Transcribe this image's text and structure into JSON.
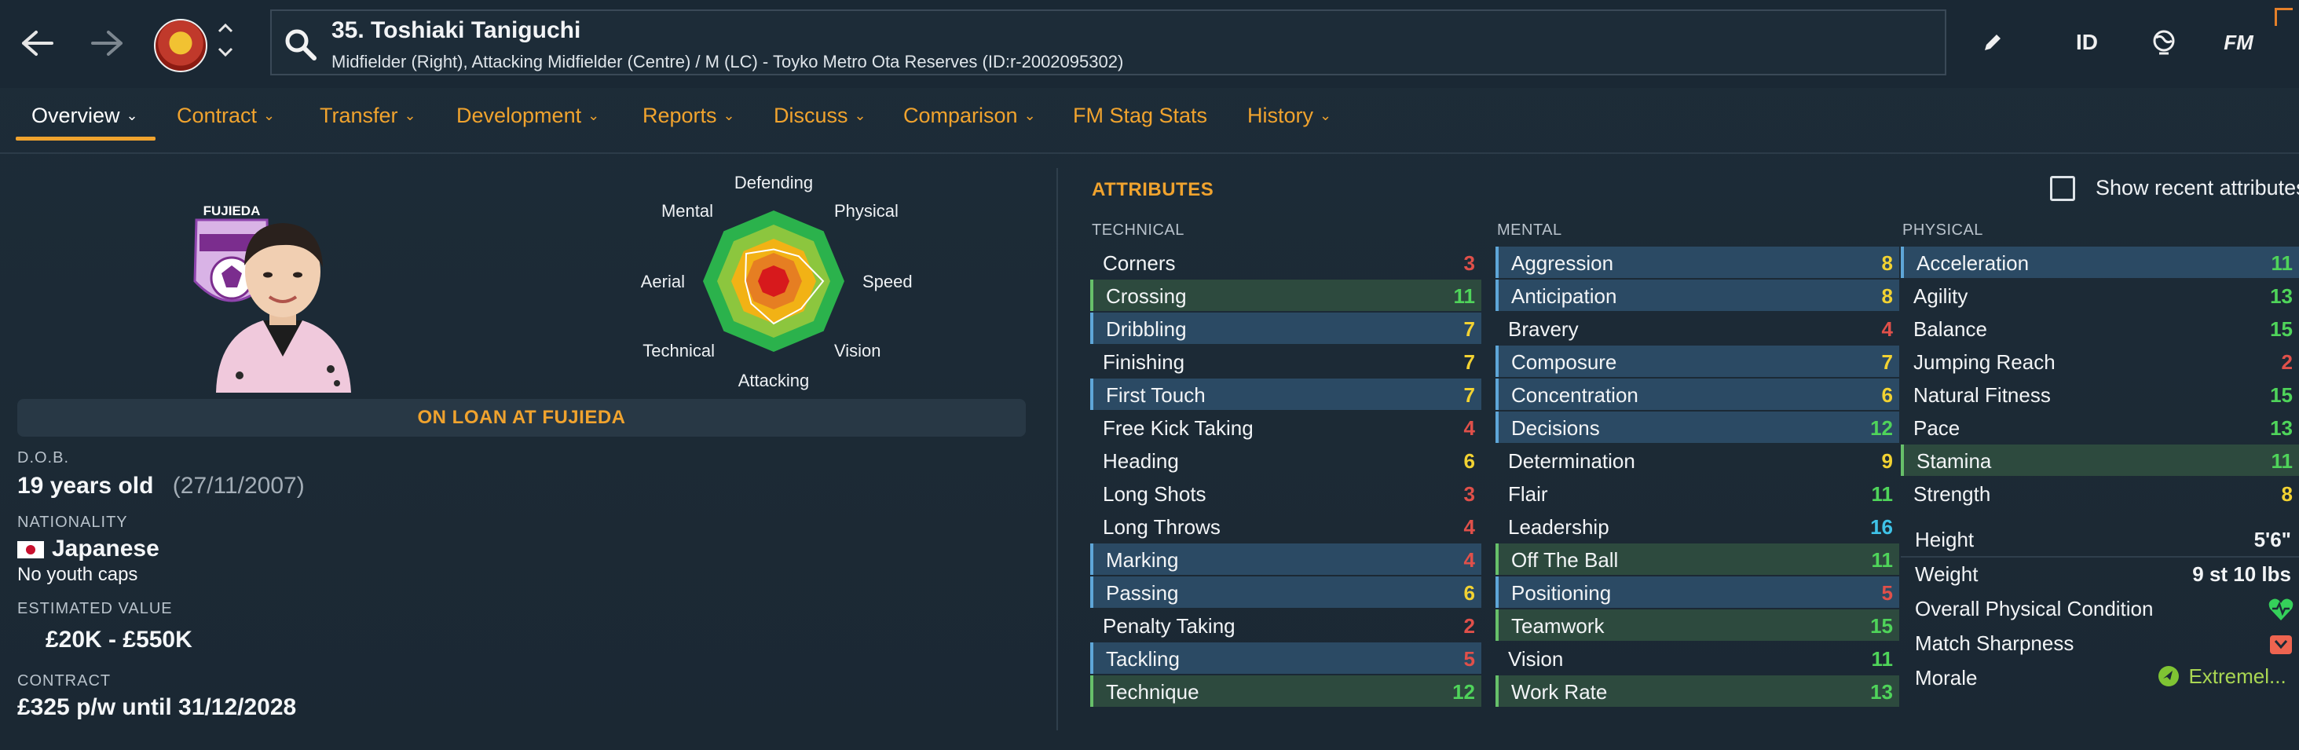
{
  "header": {
    "player_title": "35. Toshiaki Taniguchi",
    "player_subtitle": "Midfielder (Right), Attacking Midfielder (Centre) / M (LC) - Toyko Metro Ota Reserves (ID:r-2002095302)",
    "icons": [
      "back-arrow-icon",
      "forward-arrow-icon",
      "club-badge",
      "chevron-up-down-icon",
      "search-icon",
      "edit-pencil-icon",
      "id-icon",
      "globe-icon",
      "fm-logo-icon"
    ],
    "id_label": "ID",
    "fm_label": "FM"
  },
  "tabs": [
    {
      "label": "Overview",
      "dropdown": true
    },
    {
      "label": "Contract",
      "dropdown": true
    },
    {
      "label": "Transfer",
      "dropdown": true
    },
    {
      "label": "Development",
      "dropdown": true
    },
    {
      "label": "Reports",
      "dropdown": true
    },
    {
      "label": "Discuss",
      "dropdown": true
    },
    {
      "label": "Comparison",
      "dropdown": true
    },
    {
      "label": "FM Stag Stats",
      "dropdown": false
    },
    {
      "label": "History",
      "dropdown": true
    }
  ],
  "radar": {
    "labels": [
      "Defending",
      "Physical",
      "Speed",
      "Vision",
      "Attacking",
      "Technical",
      "Aerial",
      "Mental"
    ],
    "colors": {
      "outer": "#2bb24c",
      "mid": "#8cc63e",
      "inner1": "#f2b215",
      "inner2": "#e67e22",
      "core": "#d7191c",
      "line": "#ffffff"
    }
  },
  "profile": {
    "loan_banner": "ON LOAN AT FUJIEDA",
    "loan_club_badge_text": "FUJIEDA",
    "dob_label": "D.O.B.",
    "age": "19 years old",
    "dob": "(27/11/2007)",
    "nationality_label": "NATIONALITY",
    "nationality": "Japanese",
    "youth_caps": "No youth caps",
    "value_label": "ESTIMATED VALUE",
    "value": "£20K - £550K",
    "contract_label": "CONTRACT",
    "contract": "£325 p/w until 31/12/2028"
  },
  "attributes": {
    "title": "ATTRIBUTES",
    "show_recent_label": "Show recent attributes",
    "technical": {
      "header": "TECHNICAL",
      "rows": [
        {
          "name": "Corners",
          "value": "3"
        },
        {
          "name": "Crossing",
          "value": "11"
        },
        {
          "name": "Dribbling",
          "value": "7"
        },
        {
          "name": "Finishing",
          "value": "7"
        },
        {
          "name": "First Touch",
          "value": "7"
        },
        {
          "name": "Free Kick Taking",
          "value": "4"
        },
        {
          "name": "Heading",
          "value": "6"
        },
        {
          "name": "Long Shots",
          "value": "3"
        },
        {
          "name": "Long Throws",
          "value": "4"
        },
        {
          "name": "Marking",
          "value": "4"
        },
        {
          "name": "Passing",
          "value": "6"
        },
        {
          "name": "Penalty Taking",
          "value": "2"
        },
        {
          "name": "Tackling",
          "value": "5"
        },
        {
          "name": "Technique",
          "value": "12"
        }
      ]
    },
    "mental": {
      "header": "MENTAL",
      "rows": [
        {
          "name": "Aggression",
          "value": "8"
        },
        {
          "name": "Anticipation",
          "value": "8"
        },
        {
          "name": "Bravery",
          "value": "4"
        },
        {
          "name": "Composure",
          "value": "7"
        },
        {
          "name": "Concentration",
          "value": "6"
        },
        {
          "name": "Decisions",
          "value": "12"
        },
        {
          "name": "Determination",
          "value": "9"
        },
        {
          "name": "Flair",
          "value": "11"
        },
        {
          "name": "Leadership",
          "value": "16"
        },
        {
          "name": "Off The Ball",
          "value": "11"
        },
        {
          "name": "Positioning",
          "value": "5"
        },
        {
          "name": "Teamwork",
          "value": "15"
        },
        {
          "name": "Vision",
          "value": "11"
        },
        {
          "name": "Work Rate",
          "value": "13"
        }
      ]
    },
    "physical": {
      "header": "PHYSICAL",
      "rows": [
        {
          "name": "Acceleration",
          "value": "11"
        },
        {
          "name": "Agility",
          "value": "13"
        },
        {
          "name": "Balance",
          "value": "15"
        },
        {
          "name": "Jumping Reach",
          "value": "2"
        },
        {
          "name": "Natural Fitness",
          "value": "15"
        },
        {
          "name": "Pace",
          "value": "13"
        },
        {
          "name": "Stamina",
          "value": "11"
        },
        {
          "name": "Strength",
          "value": "8"
        }
      ]
    },
    "info": {
      "height_label": "Height",
      "height": "5'6\"",
      "weight_label": "Weight",
      "weight": "9 st 10 lbs",
      "condition_label": "Overall Physical Condition",
      "sharpness_label": "Match Sharpness",
      "morale_label": "Morale",
      "morale": "Extremel..."
    }
  },
  "colors": {
    "accent": "#f0a32e",
    "low": "#e0504a",
    "mid": "#f2d232",
    "high": "#4fd45a",
    "top": "#3fc3e8"
  }
}
